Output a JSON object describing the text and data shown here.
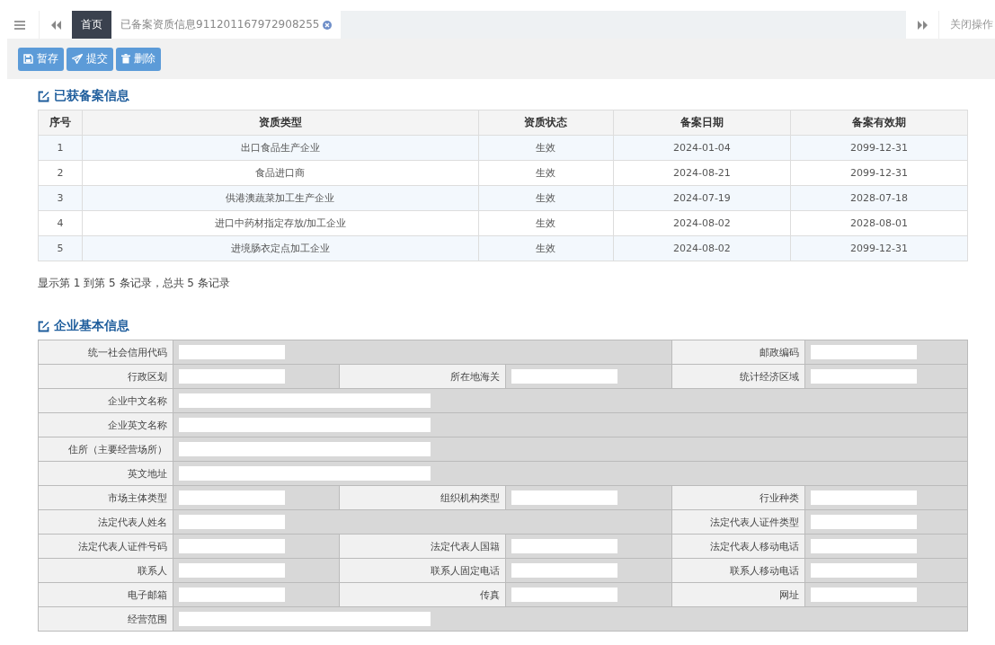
{
  "tabs": [
    {
      "label": "首页",
      "selected": true,
      "closable": false
    },
    {
      "label": "已备案资质信息911201167972908255",
      "selected": false,
      "closable": true
    }
  ],
  "close_menu": "关闭操作",
  "toolbar": [
    {
      "label": "暂存"
    },
    {
      "label": "提交"
    },
    {
      "label": "删除"
    }
  ],
  "records": {
    "title": "已获备案信息",
    "columns": [
      "序号",
      "资质类型",
      "资质状态",
      "备案日期",
      "备案有效期"
    ],
    "rows": [
      [
        "1",
        "出口食品生产企业",
        "生效",
        "2024-01-04",
        "2099-12-31"
      ],
      [
        "2",
        "食品进口商",
        "生效",
        "2024-08-21",
        "2099-12-31"
      ],
      [
        "3",
        "供港澳蔬菜加工生产企业",
        "生效",
        "2024-07-19",
        "2028-07-18"
      ],
      [
        "4",
        "进口中药材指定存放/加工企业",
        "生效",
        "2024-08-02",
        "2028-08-01"
      ],
      [
        "5",
        "进境肠衣定点加工企业",
        "生效",
        "2024-08-02",
        "2099-12-31"
      ]
    ],
    "summary": "显示第 1 到第 5 条记录，总共 5 条记录"
  },
  "basic_info": {
    "title": "企业基本信息",
    "rows": [
      {
        "kind": "wide_pair",
        "fields": [
          "统一社会信用代码",
          "邮政编码"
        ]
      },
      {
        "kind": "triple",
        "fields": [
          "行政区划",
          "所在地海关",
          "统计经济区域"
        ]
      },
      {
        "kind": "single",
        "fields": [
          "企业中文名称"
        ]
      },
      {
        "kind": "single",
        "fields": [
          "企业英文名称"
        ]
      },
      {
        "kind": "single",
        "fields": [
          "住所（主要经营场所）"
        ]
      },
      {
        "kind": "single",
        "fields": [
          "英文地址"
        ]
      },
      {
        "kind": "triple",
        "fields": [
          "市场主体类型",
          "组织机构类型",
          "行业种类"
        ]
      },
      {
        "kind": "wide_pair",
        "fields": [
          "法定代表人姓名",
          "法定代表人证件类型"
        ]
      },
      {
        "kind": "triple",
        "fields": [
          "法定代表人证件号码",
          "法定代表人国籍",
          "法定代表人移动电话"
        ]
      },
      {
        "kind": "triple",
        "fields": [
          "联系人",
          "联系人固定电话",
          "联系人移动电话"
        ]
      },
      {
        "kind": "triple",
        "fields": [
          "电子邮箱",
          "传真",
          "网址"
        ]
      },
      {
        "kind": "single",
        "fields": [
          "经营范围"
        ]
      }
    ]
  }
}
